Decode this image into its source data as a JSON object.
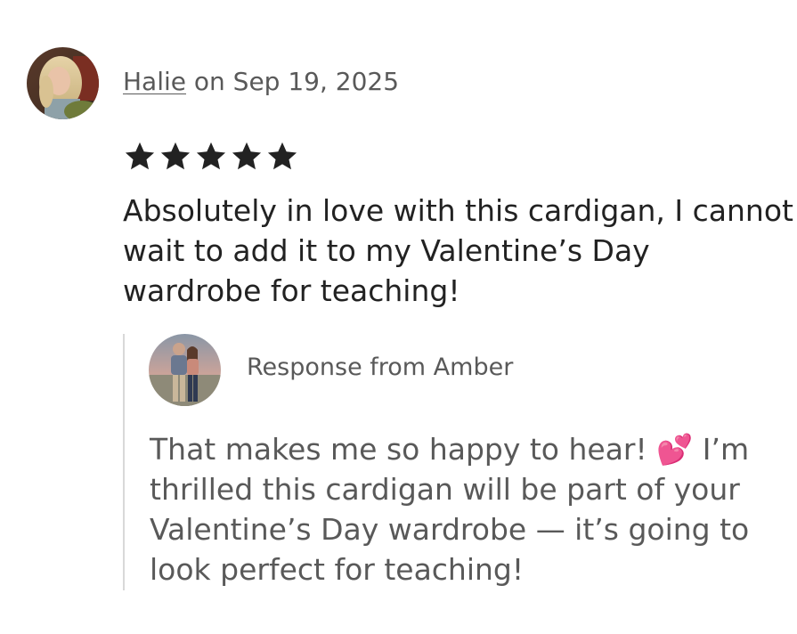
{
  "review": {
    "reviewer_name": "Halie",
    "date_text": "on Sep 19, 2025",
    "rating": 5,
    "rating_max": 5,
    "text": "Absolutely in love with this cardigan, I cannot wait to add it to my Valentine’s Day wardrobe for teaching!"
  },
  "response": {
    "label": "Response from Amber",
    "text": "That makes me so happy to hear! 💕 I’m thrilled this cardigan will be part of your Valentine’s Day wardrobe — it’s going to look perfect for teaching!"
  },
  "colors": {
    "text_primary": "#222222",
    "text_secondary": "#595959",
    "star": "#222222",
    "divider": "#d8d8d8"
  },
  "icons": {
    "star": "star-filled-icon"
  }
}
